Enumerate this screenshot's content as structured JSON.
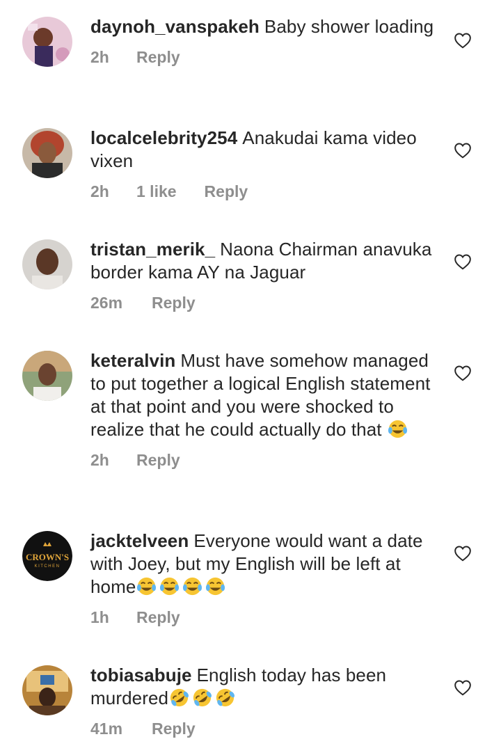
{
  "comments": [
    {
      "username": "daynoh_vanspakeh",
      "text": "Baby shower loading",
      "time": "2h",
      "likes": "",
      "reply_label": "Reply"
    },
    {
      "username": "localcelebrity254",
      "text": "Anakudai kama video vixen",
      "time": "2h",
      "likes": "1 like",
      "reply_label": "Reply"
    },
    {
      "username": "tristan_merik_",
      "text": "Naona Chairman anavuka border kama AY na Jaguar",
      "time": "26m",
      "likes": "",
      "reply_label": "Reply"
    },
    {
      "username": "keteralvin",
      "text": "Must have somehow managed to put together a logical English statement at that point and you were shocked to realize that he could actually do that",
      "emoji": [
        "tears-of-joy"
      ],
      "time": "2h",
      "likes": "",
      "reply_label": "Reply"
    },
    {
      "username": "jacktelveen",
      "text": "Everyone would want a date with Joey, but my English will be left at home",
      "emoji": [
        "tears-of-joy",
        "tears-of-joy",
        "tears-of-joy",
        "tears-of-joy"
      ],
      "time": "1h",
      "likes": "",
      "reply_label": "Reply",
      "avatar_logo": "CROWN'S KITCHEN"
    },
    {
      "username": "tobiasabuje",
      "text": "English today has been murdered",
      "emoji": [
        "rolling-on-floor-laughing",
        "rolling-on-floor-laughing",
        "rolling-on-floor-laughing"
      ],
      "time": "41m",
      "likes": "",
      "reply_label": "Reply"
    }
  ],
  "icons": {
    "like": "heart-outline-icon"
  },
  "colors": {
    "text": "#262626",
    "meta": "#8e8e8e",
    "emoji_face": "#f7c532"
  }
}
